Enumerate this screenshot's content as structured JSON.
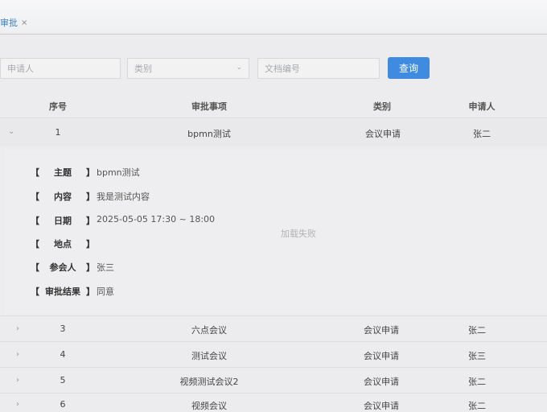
{
  "tab": {
    "label": "审批",
    "close": "×"
  },
  "filters": {
    "applicant_placeholder": "申请人",
    "category_placeholder": "类别",
    "doc_no_placeholder": "文档编号",
    "query_label": "查询"
  },
  "table": {
    "headers": [
      "序号",
      "审批事项",
      "类别",
      "申请人"
    ],
    "expanded_row": {
      "arrow": "⌄",
      "no": "1",
      "item": "bpmn测试",
      "category": "会议申请",
      "applicant": "张二"
    },
    "details": [
      {
        "label": "主题",
        "value": "bpmn测试"
      },
      {
        "label": "内容",
        "value": "我是测试内容"
      },
      {
        "label": "日期",
        "value": "2025-05-05   17:30 ~ 18:00"
      },
      {
        "label": "地点",
        "value": ""
      },
      {
        "label": "参会人",
        "value": "张三"
      },
      {
        "label": "审批结果",
        "value": "同意"
      }
    ],
    "loading_text": "加载失败",
    "rows": [
      {
        "arrow": "›",
        "no": "3",
        "item": "六点会议",
        "category": "会议申请",
        "applicant": "张二"
      },
      {
        "arrow": "›",
        "no": "4",
        "item": "测试会议",
        "category": "会议申请",
        "applicant": "张三"
      },
      {
        "arrow": "›",
        "no": "5",
        "item": "视频测试会议2",
        "category": "会议申请",
        "applicant": "张二"
      },
      {
        "arrow": "›",
        "no": "6",
        "item": "视频会议",
        "category": "会议申请",
        "applicant": "张二"
      }
    ]
  },
  "colors": {
    "accent": "#3e8be0"
  }
}
